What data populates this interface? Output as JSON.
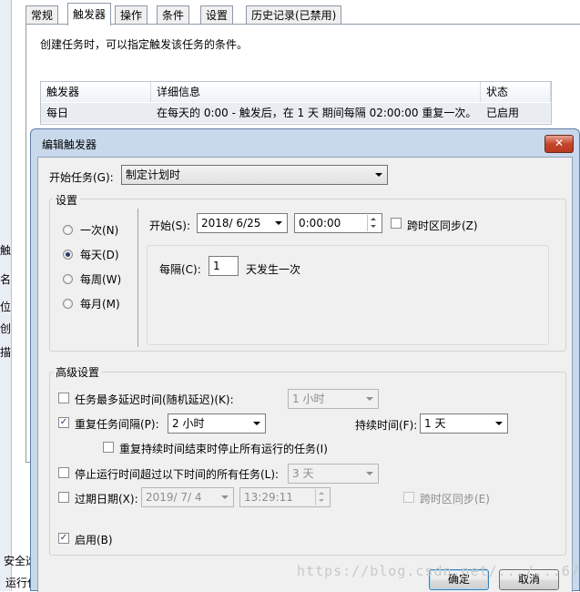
{
  "background_window": {
    "tabs": [
      "常规",
      "触发器",
      "操作",
      "条件",
      "设置",
      "历史记录(已禁用)"
    ],
    "active_tab": "触发器",
    "description": "创建任务时，可以指定触发该任务的条件。",
    "table": {
      "columns": [
        "触发器",
        "详细信息",
        "状态"
      ],
      "rows": [
        {
          "trigger": "每日",
          "details": "在每天的 0:00 - 触发后，在 1 天 期间每隔 02:00:00 重复一次。",
          "status": "已启用"
        }
      ]
    },
    "left_fragments": [
      "触",
      "名",
      "位",
      "创",
      "描"
    ],
    "bottom_text_1": "安全选",
    "bottom_text_2": "运行任"
  },
  "dialog": {
    "title": "编辑触发器",
    "close_glyph": "✕",
    "begin_task": {
      "label": "开始任务(G):",
      "value": "制定计划时"
    },
    "settings": {
      "group_title": "设置",
      "radios": [
        {
          "label": "一次(N)",
          "selected": false
        },
        {
          "label": "每天(D)",
          "selected": true
        },
        {
          "label": "每周(W)",
          "selected": false
        },
        {
          "label": "每月(M)",
          "selected": false
        }
      ],
      "start_label": "开始(S):",
      "start_date": "2018/ 6/25",
      "start_time": "0:00:00",
      "sync_timezone_label": "跨时区同步(Z)",
      "recur_label": "每隔(C):",
      "recur_value": "1",
      "recur_suffix": "天发生一次"
    },
    "advanced": {
      "group_title": "高级设置",
      "delay": {
        "label": "任务最多延迟时间(随机延迟)(K):",
        "value": "1 小时",
        "checked": false
      },
      "repeat": {
        "label": "重复任务间隔(P):",
        "value": "2 小时",
        "checked": true
      },
      "duration": {
        "label": "持续时间(F):",
        "value": "1 天"
      },
      "stop_at_end": {
        "label": "重复持续时间结束时停止所有运行的任务(I)",
        "checked": false
      },
      "stop_longer": {
        "label": "停止运行时间超过以下时间的所有任务(L):",
        "value": "3 天",
        "checked": false
      },
      "expire": {
        "label": "过期日期(X):",
        "date": "2019/ 7/ 4",
        "time": "13:29:11",
        "checked": false,
        "sync_label": "跨时区同步(E)"
      },
      "enabled": {
        "label": "启用(B)",
        "checked": true
      }
    },
    "buttons": {
      "ok": "确定",
      "cancel": "取消"
    }
  },
  "watermark": "https://blog.csdn.net/.../...67"
}
